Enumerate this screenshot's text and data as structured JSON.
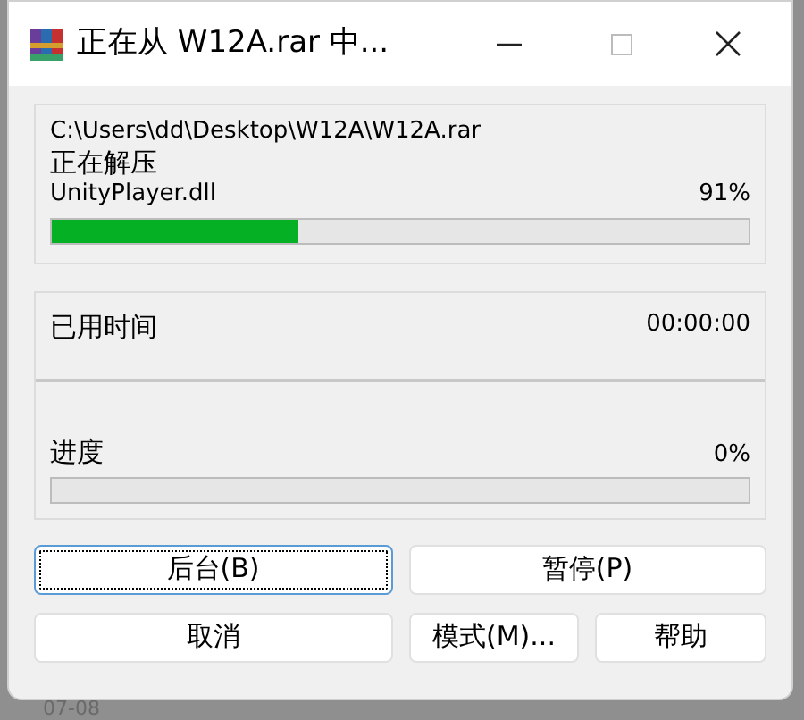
{
  "window": {
    "title": "正在从 W12A.rar 中..."
  },
  "archive": {
    "path": "C:\\Users\\dd\\Desktop\\W12A\\W12A.rar",
    "action": "正在解压",
    "file": "UnityPlayer.dll",
    "percent": "91%",
    "level": 0.355
  },
  "elapsed": {
    "label": "已用时间",
    "value": "00:00:00"
  },
  "progress": {
    "label": "进度",
    "percent": "0%"
  },
  "buttons": [
    {
      "label": "后台(B)",
      "focused": true
    },
    {
      "label": "暂停(P)",
      "focused": false
    },
    {
      "label": "取消",
      "focused": false
    },
    {
      "label": "模式(M)...",
      "focused": false
    },
    {
      "label": "帮助",
      "focused": false
    }
  ],
  "background": {
    "text": "07-08"
  }
}
